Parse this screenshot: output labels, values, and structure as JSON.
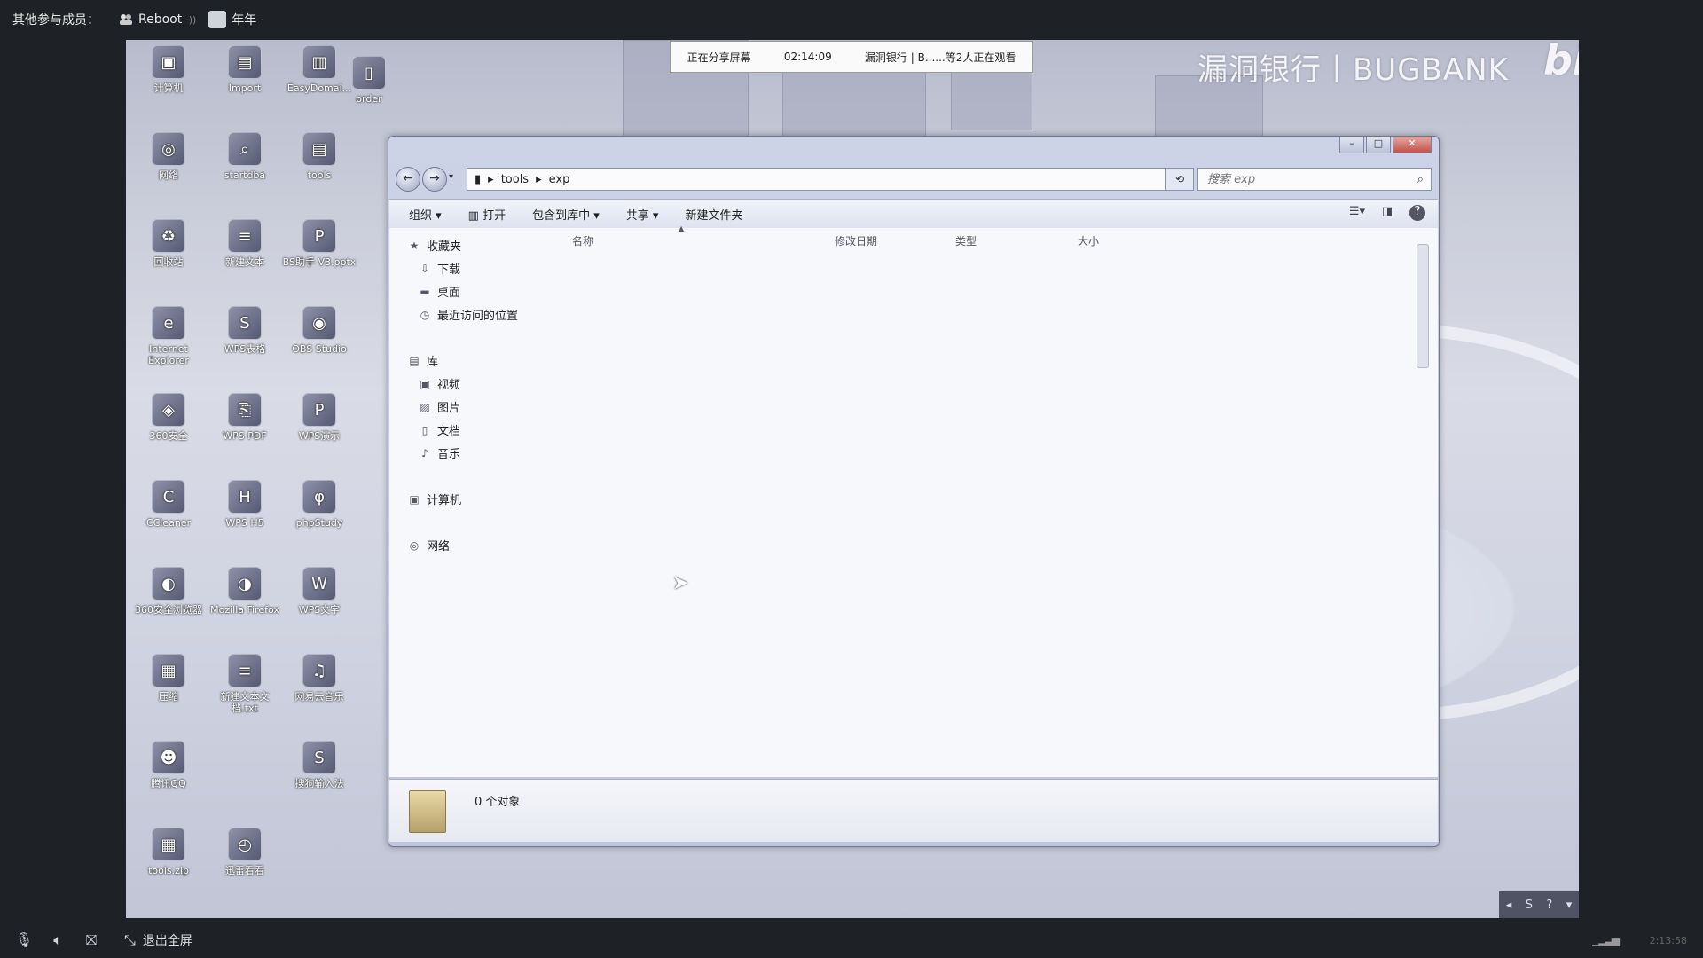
{
  "meeting": {
    "members_label": "其他参与成员：",
    "members": [
      {
        "name": "Reboot",
        "icon": "users-icon"
      },
      {
        "name": "年年",
        "icon": "avatar-icon"
      }
    ],
    "exit_fullscreen_label": "退出全屏",
    "clock": "2:13:58"
  },
  "share_bar": {
    "status": "正在分享屏幕",
    "timer": "02:14:09",
    "viewers": "漏洞银行 | B......等2人正在观看"
  },
  "watermark": {
    "text": "漏洞银行丨BUGBANK",
    "logo": "bilibili"
  },
  "desktop_icons": [
    {
      "label": "计算机"
    },
    {
      "label": "Import"
    },
    {
      "label": "EasyDomai..."
    },
    {
      "label": "order"
    },
    {
      "label": "网络"
    },
    {
      "label": "startdba"
    },
    {
      "label": "tools"
    },
    {
      "label": "回收站"
    },
    {
      "label": "新建文本"
    },
    {
      "label": "BS助手 V3.pptx"
    },
    {
      "label": "Internet Explorer"
    },
    {
      "label": "WPS表格"
    },
    {
      "label": "OBS Studio"
    },
    {
      "label": "360安全"
    },
    {
      "label": "WPS PDF"
    },
    {
      "label": "WPS演示"
    },
    {
      "label": "CCleaner"
    },
    {
      "label": "WPS H5"
    },
    {
      "label": "phpStudy"
    },
    {
      "label": "360安全浏览器"
    },
    {
      "label": "Mozilla Firefox"
    },
    {
      "label": "WPS文字"
    },
    {
      "label": "压缩"
    },
    {
      "label": "新建文本文档.txt"
    },
    {
      "label": "网易云音乐"
    },
    {
      "label": "腾讯QQ"
    },
    {
      "label": "搜狗输入法"
    },
    {
      "label": "tools.zip"
    },
    {
      "label": "迅雷看看"
    }
  ],
  "explorer": {
    "breadcrumb": [
      "tools",
      "exp"
    ],
    "search_placeholder": "搜索 exp",
    "toolbar": [
      "组织 ▾",
      "打开",
      "包含到库中 ▾",
      "共享 ▾",
      "新建文件夹"
    ],
    "nav": {
      "favorites_label": "收藏夹",
      "favorites": [
        "下载",
        "桌面",
        "最近访问的位置"
      ],
      "libraries_label": "库",
      "libraries": [
        "视频",
        "图片",
        "文档",
        "音乐"
      ],
      "computer_label": "计算机",
      "network_label": "网络"
    },
    "columns": [
      "名称",
      "修改日期",
      "类型",
      "大小"
    ],
    "status_text": "0 个对象"
  }
}
